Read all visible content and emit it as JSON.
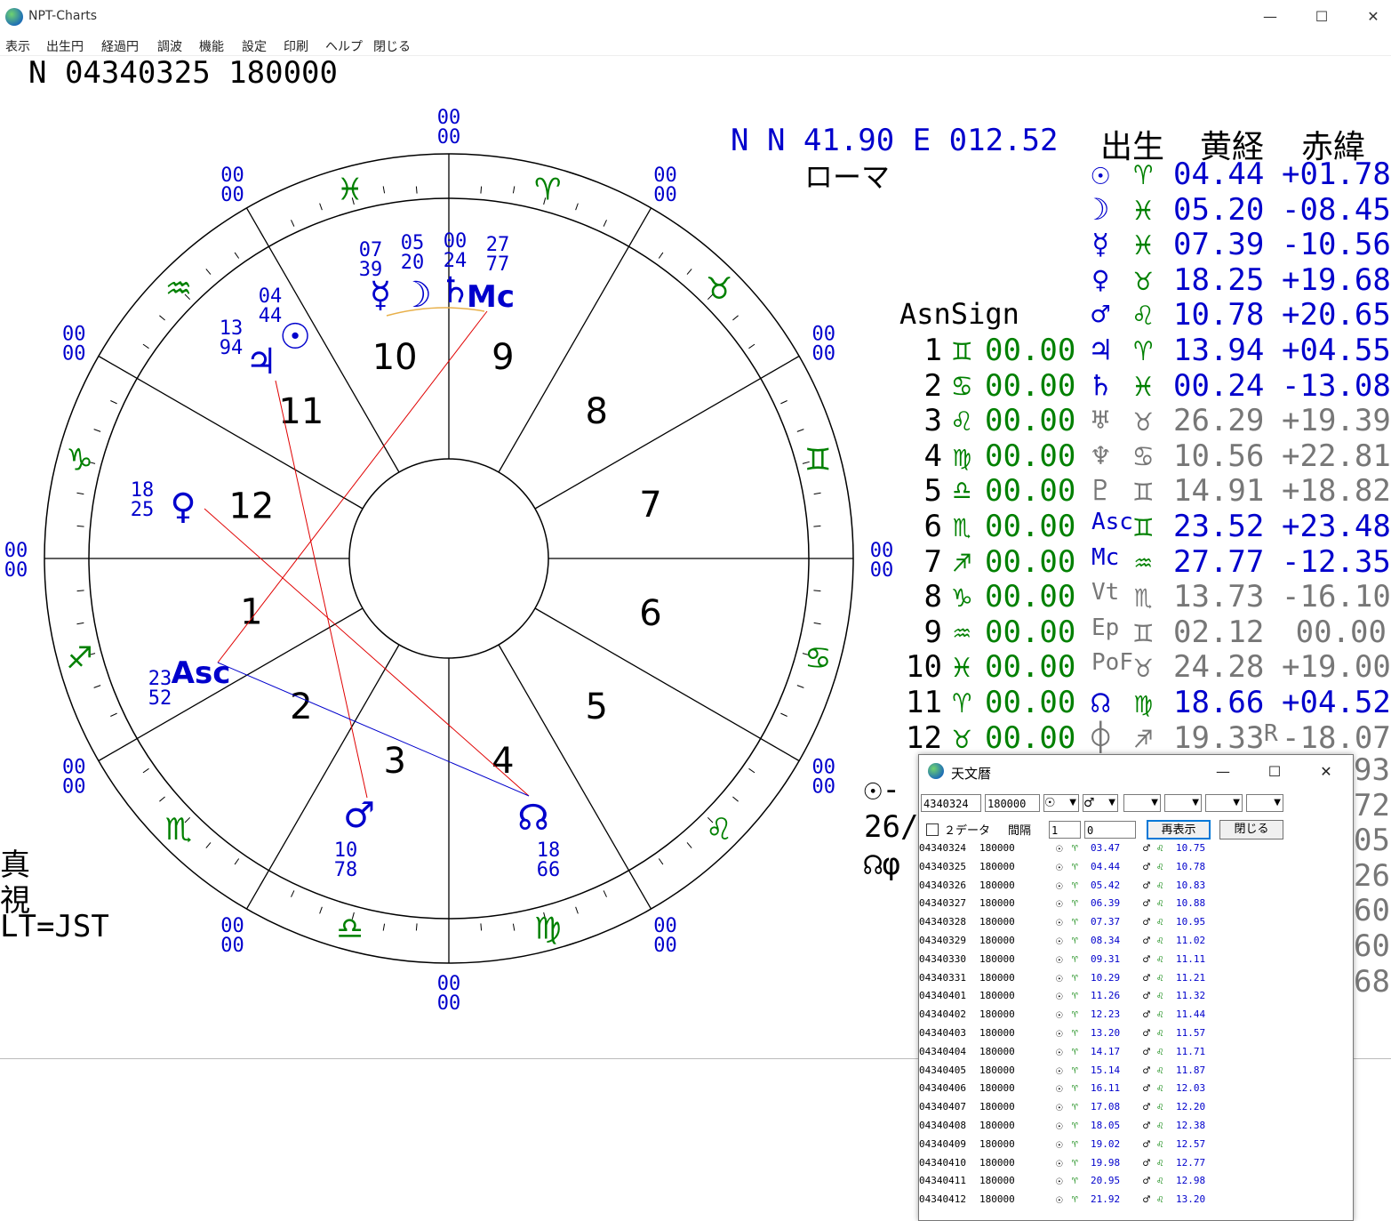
{
  "window": {
    "title": "NPT-Charts",
    "minimize": "—",
    "maximize": "☐",
    "close": "✕"
  },
  "menu": [
    "表示",
    "出生円",
    "経過円",
    "調波",
    "機能",
    "設定",
    "印刷",
    "ヘルプ",
    "閉じる"
  ],
  "chart_title": "N 04340325 180000",
  "location": {
    "coords": "N N  41.90 E 012.52",
    "city": "ローマ"
  },
  "table_headers": {
    "birth": "出生",
    "longitude": "黄経",
    "declination": "赤緯"
  },
  "colors": {
    "blue": "#0000cc",
    "green": "#008000",
    "gray": "#777777",
    "red": "#e00000",
    "aspect_blue": "#0000cc",
    "accent": "#e8b04a"
  },
  "planets": [
    {
      "glyph": "☉",
      "sign": "♈",
      "lon": "04.44",
      "dec": "+01.78",
      "r": "",
      "color": "blue"
    },
    {
      "glyph": "☽",
      "sign": "♓",
      "lon": "05.20",
      "dec": "-08.45",
      "r": "",
      "color": "blue"
    },
    {
      "glyph": "☿",
      "sign": "♓",
      "lon": "07.39",
      "dec": "-10.56",
      "r": "",
      "color": "blue"
    },
    {
      "glyph": "♀",
      "sign": "♉",
      "lon": "18.25",
      "dec": "+19.68",
      "r": "",
      "color": "blue"
    },
    {
      "glyph": "♂",
      "sign": "♌",
      "lon": "10.78",
      "dec": "+20.65",
      "r": "",
      "color": "blue"
    },
    {
      "glyph": "♃",
      "sign": "♈",
      "lon": "13.94",
      "dec": "+04.55",
      "r": "",
      "color": "blue"
    },
    {
      "glyph": "♄",
      "sign": "♓",
      "lon": "00.24",
      "dec": "-13.08",
      "r": "",
      "color": "blue"
    },
    {
      "glyph": "♅",
      "sign": "♉",
      "lon": "26.29",
      "dec": "+19.39",
      "r": "",
      "color": "gray"
    },
    {
      "glyph": "♆",
      "sign": "♋",
      "lon": "10.56",
      "dec": "+22.81",
      "r": "",
      "color": "gray"
    },
    {
      "glyph": "♇",
      "sign": "♊",
      "lon": "14.91",
      "dec": "+18.82",
      "r": "",
      "color": "gray"
    },
    {
      "glyph": "Asc",
      "sign": "♊",
      "lon": "23.52",
      "dec": "+23.48",
      "r": "",
      "color": "blue"
    },
    {
      "glyph": "Mc",
      "sign": "♒",
      "lon": "27.77",
      "dec": "-12.35",
      "r": "",
      "color": "blue"
    },
    {
      "glyph": "Vt",
      "sign": "♏",
      "lon": "13.73",
      "dec": "-16.10",
      "r": "",
      "color": "gray"
    },
    {
      "glyph": "Ep",
      "sign": "♊",
      "lon": "02.12",
      "dec": "00.00",
      "r": "",
      "color": "gray"
    },
    {
      "glyph": "PoF",
      "sign": "♉",
      "lon": "24.28",
      "dec": "+19.00",
      "r": "",
      "color": "gray"
    },
    {
      "glyph": "☊",
      "sign": "♍",
      "lon": "18.66",
      "dec": "+04.52",
      "r": "",
      "color": "blue"
    },
    {
      "glyph": "⌽",
      "sign": "♐",
      "lon": "19.33",
      "dec": "-18.07",
      "r": "R",
      "color": "gray"
    }
  ],
  "asn_label": "AsnSign",
  "houses": [
    {
      "n": "1",
      "sign": "♊",
      "deg": "00.00"
    },
    {
      "n": "2",
      "sign": "♋",
      "deg": "00.00"
    },
    {
      "n": "3",
      "sign": "♌",
      "deg": "00.00"
    },
    {
      "n": "4",
      "sign": "♍",
      "deg": "00.00"
    },
    {
      "n": "5",
      "sign": "♎",
      "deg": "00.00"
    },
    {
      "n": "6",
      "sign": "♏",
      "deg": "00.00"
    },
    {
      "n": "7",
      "sign": "♐",
      "deg": "00.00"
    },
    {
      "n": "8",
      "sign": "♑",
      "deg": "00.00"
    },
    {
      "n": "9",
      "sign": "♒",
      "deg": "00.00"
    },
    {
      "n": "10",
      "sign": "♓",
      "deg": "00.00"
    },
    {
      "n": "11",
      "sign": "♈",
      "deg": "00.00"
    },
    {
      "n": "12",
      "sign": "♉",
      "deg": "00.00"
    }
  ],
  "left_notes": [
    "真",
    "視",
    "LT=JST"
  ],
  "partial_fragments": {
    "sun_line": "☉-",
    "date_line": "26/",
    "node_line": "☊φ"
  },
  "hidden_right_numbers": [
    "93",
    "72",
    "05",
    "26",
    "60",
    "60",
    "68"
  ],
  "wheel": {
    "cusp_labels": [
      "00",
      "00"
    ],
    "house_numbers": [
      "1",
      "2",
      "3",
      "4",
      "5",
      "6",
      "7",
      "8",
      "9",
      "10",
      "11",
      "12"
    ],
    "sign_glyphs": [
      "♓",
      "♒",
      "♑",
      "♐",
      "♏",
      "♎",
      "♍",
      "♌",
      "♋",
      "♊",
      "♉",
      "♈"
    ],
    "planet_markers": [
      {
        "glyph": "☿",
        "deg": "07",
        "min": "39"
      },
      {
        "glyph": "☽",
        "deg": "05",
        "min": "20"
      },
      {
        "glyph": "♄",
        "deg": "00",
        "min": "24"
      },
      {
        "glyph": "Mc",
        "deg": "27",
        "min": "77"
      },
      {
        "glyph": "☉",
        "deg": "04",
        "min": "44"
      },
      {
        "glyph": "♃",
        "deg": "13",
        "min": "94"
      },
      {
        "glyph": "♀",
        "deg": "18",
        "min": "25"
      },
      {
        "glyph": "Asc",
        "deg": "23",
        "min": "52"
      },
      {
        "glyph": "♂",
        "deg": "10",
        "min": "78"
      },
      {
        "glyph": "☊",
        "deg": "18",
        "min": "66"
      }
    ]
  },
  "ephemeris_dialog": {
    "title": "天文暦",
    "date_input": "4340324",
    "time_input": "180000",
    "planet_select_1": "☉",
    "planet_select_2": "♂",
    "two_data_label": "２データ",
    "interval_label": "間隔",
    "interval_value": "1",
    "offset_value": "0",
    "redisplay_button": "再表示",
    "close_button": "閉じる",
    "rows": [
      {
        "date": "04340324",
        "time": "180000",
        "sun": "03.47",
        "mars": "10.75"
      },
      {
        "date": "04340325",
        "time": "180000",
        "sun": "04.44",
        "mars": "10.78"
      },
      {
        "date": "04340326",
        "time": "180000",
        "sun": "05.42",
        "mars": "10.83"
      },
      {
        "date": "04340327",
        "time": "180000",
        "sun": "06.39",
        "mars": "10.88"
      },
      {
        "date": "04340328",
        "time": "180000",
        "sun": "07.37",
        "mars": "10.95"
      },
      {
        "date": "04340329",
        "time": "180000",
        "sun": "08.34",
        "mars": "11.02"
      },
      {
        "date": "04340330",
        "time": "180000",
        "sun": "09.31",
        "mars": "11.11"
      },
      {
        "date": "04340331",
        "time": "180000",
        "sun": "10.29",
        "mars": "11.21"
      },
      {
        "date": "04340401",
        "time": "180000",
        "sun": "11.26",
        "mars": "11.32"
      },
      {
        "date": "04340402",
        "time": "180000",
        "sun": "12.23",
        "mars": "11.44"
      },
      {
        "date": "04340403",
        "time": "180000",
        "sun": "13.20",
        "mars": "11.57"
      },
      {
        "date": "04340404",
        "time": "180000",
        "sun": "14.17",
        "mars": "11.71"
      },
      {
        "date": "04340405",
        "time": "180000",
        "sun": "15.14",
        "mars": "11.87"
      },
      {
        "date": "04340406",
        "time": "180000",
        "sun": "16.11",
        "mars": "12.03"
      },
      {
        "date": "04340407",
        "time": "180000",
        "sun": "17.08",
        "mars": "12.20"
      },
      {
        "date": "04340408",
        "time": "180000",
        "sun": "18.05",
        "mars": "12.38"
      },
      {
        "date": "04340409",
        "time": "180000",
        "sun": "19.02",
        "mars": "12.57"
      },
      {
        "date": "04340410",
        "time": "180000",
        "sun": "19.98",
        "mars": "12.77"
      },
      {
        "date": "04340411",
        "time": "180000",
        "sun": "20.95",
        "mars": "12.98"
      },
      {
        "date": "04340412",
        "time": "180000",
        "sun": "21.92",
        "mars": "13.20"
      }
    ],
    "row_sun_glyph": "☉",
    "row_sun_sign": "♈",
    "row_mars_glyph": "♂",
    "row_mars_sign": "♌"
  }
}
